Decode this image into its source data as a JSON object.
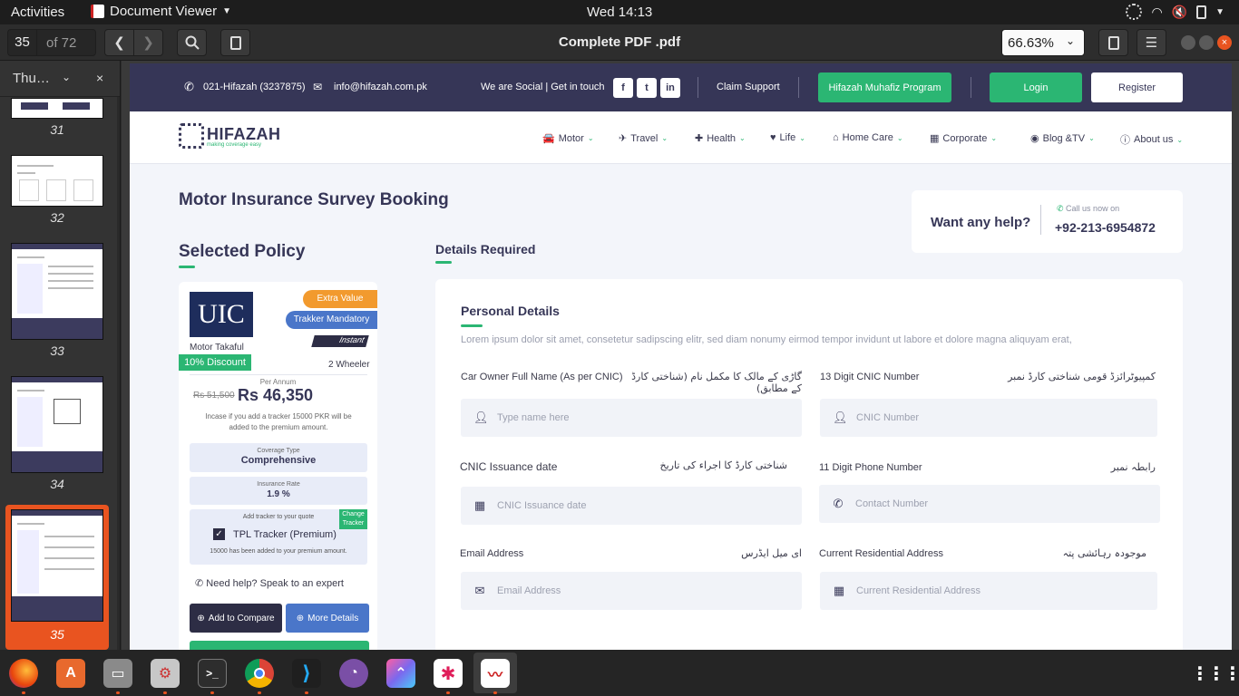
{
  "topbar": {
    "activities": "Activities",
    "app_name": "Document Viewer",
    "clock": "Wed 14:13"
  },
  "viewer": {
    "page_current": "35",
    "page_total": "of 72",
    "title": "Complete PDF .pdf",
    "zoom": "66.63%",
    "sidebar_mode": "Thu…",
    "thumbnails": [
      {
        "label": "31"
      },
      {
        "label": "32"
      },
      {
        "label": "33"
      },
      {
        "label": "34"
      },
      {
        "label": "35"
      }
    ]
  },
  "site": {
    "phone": "021-Hifazah (3237875)",
    "email": "info@hifazah.com.pk",
    "social_text": "We are Social | Get in touch",
    "social": [
      "f",
      "t",
      "in"
    ],
    "claim": "Claim Support",
    "muhafiz": "Hifazah Muhafiz Program",
    "login": "Login",
    "register": "Register",
    "logo": "HIFAZAH",
    "logo_tagline": "making coverage easy",
    "nav": [
      "Motor",
      "Travel",
      "Health",
      "Life",
      "Home Care",
      "Corporate",
      "Blog &TV",
      "About us"
    ]
  },
  "content": {
    "page_heading": "Motor Insurance Survey Booking",
    "help_title": "Want any help?",
    "help_sub": "Call us now on",
    "help_phone": "+92-213-6954872",
    "selected_policy": "Selected Policy",
    "details_required": "Details Required"
  },
  "policy": {
    "logo_text": "UIC",
    "badge_extra": "Extra Value",
    "badge_tracker": "Trakker Mandatory",
    "badge_instant": "Instant",
    "provider": "Motor Takaful",
    "discount": "10% Discount",
    "vehicle": "2 Wheeler",
    "per_annum": "Per Annum",
    "old_price": "Rs 51,500",
    "price": "Rs 46,350",
    "tracker_note": "Incase if you add a tracker 15000 PKR will be added to the premium amount.",
    "coverage_label": "Coverage Type",
    "coverage_value": "Comprehensive",
    "rate_label": "Insurance Rate",
    "rate_value": "1.9 %",
    "tracker_add": "Add tracker to your quote",
    "change_tracker": "Change Tracker",
    "tracker_name": "TPL Tracker (Premium)",
    "tracker_added": "15000 has been added to your premium amount.",
    "help": "Need help? Speak to an expert",
    "compare": "Add to Compare",
    "more": "More Details"
  },
  "form": {
    "section": "Personal Details",
    "intro": "Lorem ipsum dolor sit amet, consetetur sadipscing elitr, sed diam nonumy eirmod tempor invidunt ut labore et dolore magna aliquyam erat,",
    "name_label": "Car Owner Full Name (As per CNIC)",
    "name_urdu": "گاڑی کے مالک کا مکمل نام (شناختی کارڈ کے مطابق)",
    "name_ph": "Type name here",
    "cnic_label": "13 Digit CNIC Number",
    "cnic_urdu": "کمپیوٹرائزڈ قومی شناختی کارڈ نمبر",
    "cnic_ph": "CNIC Number",
    "issue_label": "CNIC Issuance date",
    "issue_urdu": "شناختی کارڈ کا اجراء کی تاریخ",
    "issue_ph": "CNIC Issuance date",
    "phone_label": "11 Digit Phone Number",
    "phone_urdu": "رابطہ نمبر",
    "phone_ph": "Contact Number",
    "email_label": "Email Address",
    "email_urdu": "ای میل ایڈرس",
    "email_ph": "Email Address",
    "address_label": "Current Residential Address",
    "address_urdu": "موجودہ رہائشی پتہ",
    "address_ph": "Current Residential Address"
  },
  "colors": {
    "brand_navy": "#363657",
    "brand_green": "#2bb673",
    "accent_orange": "#f29a2e",
    "accent_blue": "#4a76c9"
  }
}
